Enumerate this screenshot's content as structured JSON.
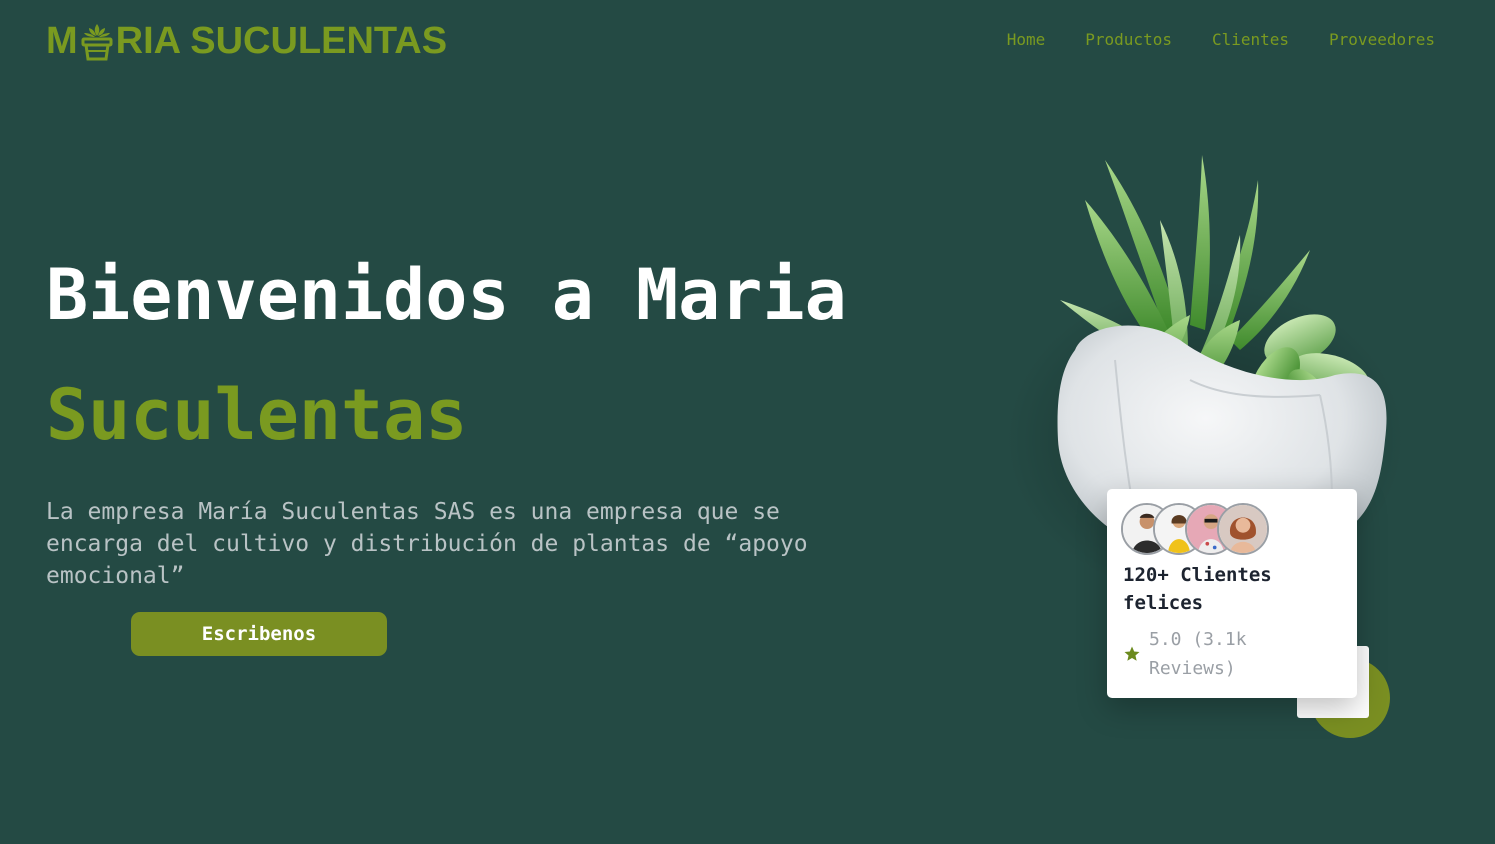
{
  "header": {
    "logo_text_start": "M",
    "logo_text_end": "RIA SUCULENTAS",
    "nav": [
      {
        "label": "Home"
      },
      {
        "label": "Productos"
      },
      {
        "label": "Clientes"
      },
      {
        "label": "Proveedores"
      }
    ]
  },
  "hero": {
    "title_line1": "Bienvenidos a Maria",
    "title_line2": "Suculentas",
    "description": "La empresa María Suculentas SAS es una empresa que se encarga del cultivo y distribución de plantas de “apoyo emocional”",
    "cta_label": "Escribenos"
  },
  "review_card": {
    "headline": "120+ Clientes felices",
    "rating": "5.0 (3.1k Reviews)",
    "star_icon": "star-icon",
    "avatars": [
      "avatar-1",
      "avatar-2",
      "avatar-3",
      "avatar-4"
    ]
  },
  "colors": {
    "background": "#244a44",
    "accent": "#7a9a20",
    "button": "#7a8f22",
    "text_light": "#ffffff",
    "text_muted": "#b9c3c5"
  }
}
